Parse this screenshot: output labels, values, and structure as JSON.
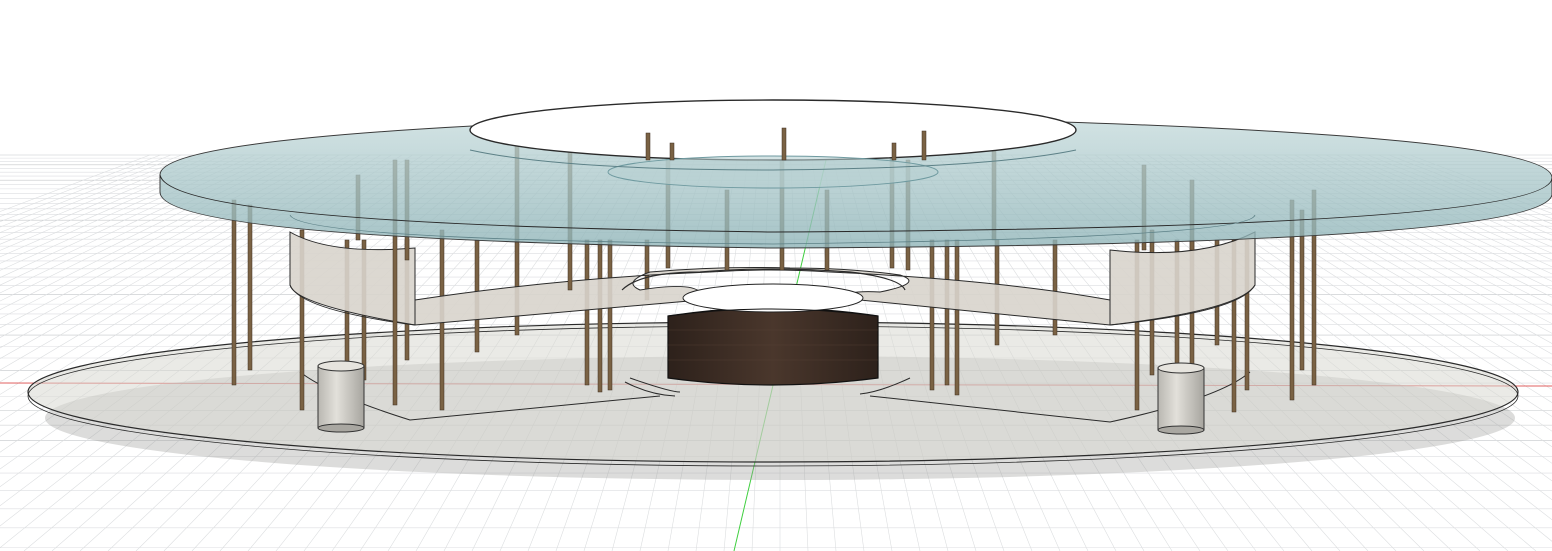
{
  "viewport": {
    "background": "#ffffff",
    "grid_color": "#c4c7ca",
    "grid_minor_color": "#dcdee0",
    "axis_x_color": "#e06060",
    "axis_y_color": "#3fcf3f"
  },
  "model": {
    "roof_glass_color": "#a9c6c9",
    "roof_edge_color": "#7fa6ab",
    "base_color": "#d9d8d2",
    "floor_color": "#d8d4cc",
    "column_color": "#7a6244",
    "core_color": "#3a2a22",
    "cylinder_color": "#c8c6c0"
  }
}
